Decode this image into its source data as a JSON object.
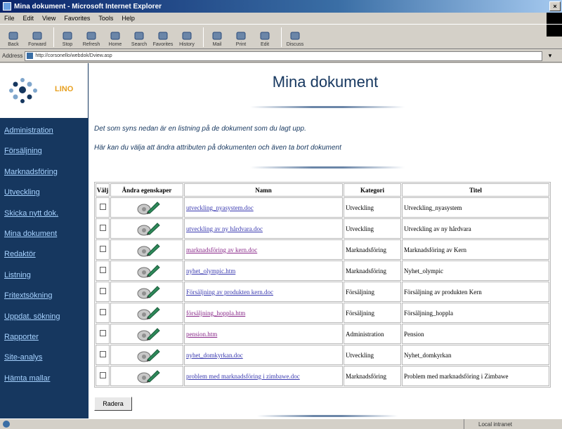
{
  "window": {
    "title": "Mina dokument - Microsoft Internet Explorer",
    "controls": "×"
  },
  "menu": [
    "File",
    "Edit",
    "View",
    "Favorites",
    "Tools",
    "Help"
  ],
  "toolbar": {
    "buttons": [
      {
        "label": "Back",
        "icon": "back-arrow-icon"
      },
      {
        "label": "Forward",
        "icon": "forward-arrow-icon"
      },
      {
        "label": "Stop",
        "icon": "stop-icon"
      },
      {
        "label": "Refresh",
        "icon": "refresh-icon"
      },
      {
        "label": "Home",
        "icon": "home-icon"
      },
      {
        "label": "Search",
        "icon": "search-icon"
      },
      {
        "label": "Favorites",
        "icon": "favorites-icon"
      },
      {
        "label": "History",
        "icon": "history-icon"
      },
      {
        "label": "Mail",
        "icon": "mail-icon"
      },
      {
        "label": "Print",
        "icon": "print-icon"
      },
      {
        "label": "Edit",
        "icon": "edit-icon"
      },
      {
        "label": "Discuss",
        "icon": "discuss-icon"
      }
    ]
  },
  "address": {
    "label": "Address",
    "url": "http://corsonello/webdok/Dview.asp",
    "go": "▾"
  },
  "logo": {
    "text": "LINO"
  },
  "sidebar": {
    "items": [
      "Administration",
      "Försäljning",
      "Marknadsföring",
      "Utveckling",
      "Skicka nytt dok.",
      "Mina dokument",
      "Redaktör",
      "Listning",
      "Fritextsökning",
      "Uppdat. sökning",
      "Rapporter",
      "Site-analys",
      "Hämta mallar"
    ]
  },
  "main": {
    "title": "Mina dokument",
    "intro1": "Det som syns nedan är en listning på de dokument som du lagt upp.",
    "intro2": "Här kan du välja att ändra attributen på dokumenten och även ta bort dokument",
    "columns": [
      "Välj",
      "Ändra egenskaper",
      "Namn",
      "Kategori",
      "Titel"
    ],
    "rows": [
      {
        "name": "utveckling_nyasystem.doc",
        "category": "Utveckling",
        "title": "Utveckling_nyasystem",
        "visited": false
      },
      {
        "name": "utveckling av ny hårdvara.doc",
        "category": "Utveckling",
        "title": "Utveckling av ny hårdvara",
        "visited": false
      },
      {
        "name": "marknadsföring av kern.doc",
        "category": "Marknadsföring",
        "title": "Marknadsföring av Kern",
        "visited": true
      },
      {
        "name": "nyhet_olympic.htm",
        "category": "Marknadsföring",
        "title": "Nyhet_olympic",
        "visited": false
      },
      {
        "name": "Försäljning av produkten kern.doc",
        "category": "Försäljning",
        "title": "Försäljning av produkten Kern",
        "visited": false
      },
      {
        "name": "försäljning_hoppla.htm",
        "category": "Försäljning",
        "title": "Försäljning_hoppla",
        "visited": true
      },
      {
        "name": "pension.htm",
        "category": "Administration",
        "title": "Pension",
        "visited": true
      },
      {
        "name": "nyhet_domkyrkan.doc",
        "category": "Utveckling",
        "title": "Nyhet_domkyrkan",
        "visited": false
      },
      {
        "name": "problem med marknadsföring i zimbawe.doc",
        "category": "Marknadsföring",
        "title": "Problem med marknadsföring i Zimbawe",
        "visited": false
      }
    ],
    "delete_label": "Radera"
  },
  "status": {
    "zone": "Local intranet"
  },
  "colors": {
    "sidebar": "#16375f",
    "nav_link": "#a6d2ff",
    "logo_accent": "#e8a020",
    "link": "#3a3ab0",
    "visited_link": "#8a2a8a"
  }
}
